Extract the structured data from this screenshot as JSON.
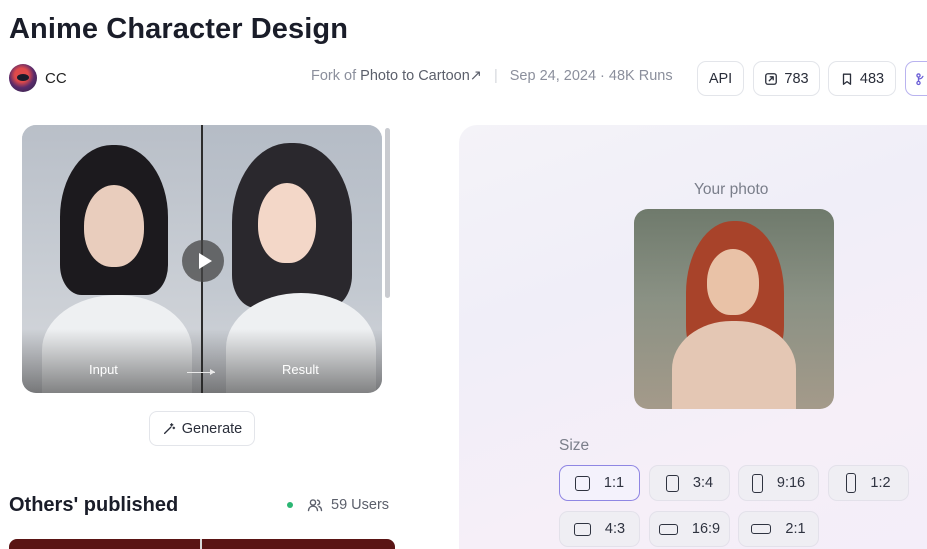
{
  "title": "Anime Character Design",
  "author": {
    "name": "CC"
  },
  "meta": {
    "fork_prefix": "Fork of",
    "fork_link": "Photo to Cartoon",
    "fork_link_icon": "↗",
    "date_runs": "Sep 24, 2024 · 48K Runs"
  },
  "toolbar": {
    "api_label": "API",
    "share_count": "783",
    "bookmark_count": "483"
  },
  "preview": {
    "input_label": "Input",
    "result_label": "Result"
  },
  "generate_label": "Generate",
  "others": {
    "title": "Others' published",
    "users_label": "59 Users",
    "status_color": "#2bb673"
  },
  "form": {
    "photo_label": "Your photo",
    "size_label": "Size",
    "size_options": [
      {
        "label": "1:1",
        "selected": true
      },
      {
        "label": "3:4",
        "selected": false
      },
      {
        "label": "9:16",
        "selected": false
      },
      {
        "label": "1:2",
        "selected": false
      },
      {
        "label": "4:3",
        "selected": false
      },
      {
        "label": "16:9",
        "selected": false
      },
      {
        "label": "2:1",
        "selected": false
      }
    ]
  },
  "colors": {
    "accent": "#8f86e3",
    "panel_bg": "#f3f1f9"
  }
}
